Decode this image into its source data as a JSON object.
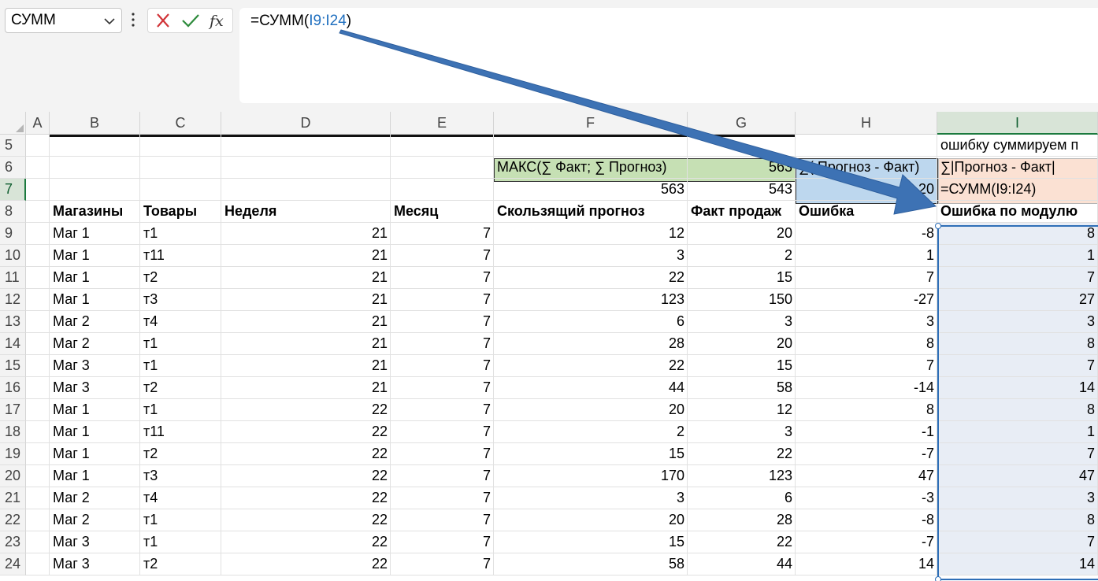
{
  "name_box": {
    "value": "СУММ"
  },
  "formula_bar": {
    "prefix": "=СУММ(",
    "ref": "I9:I24",
    "suffix": ")"
  },
  "columns": [
    "A",
    "B",
    "C",
    "D",
    "E",
    "F",
    "G",
    "H",
    "I"
  ],
  "selected_column": "I",
  "top_rows": [
    {
      "row": "5",
      "i": "ошибку суммируем п"
    },
    {
      "row": "6",
      "f": "МАКС(∑ Факт; ∑ Прогноз)",
      "g": "563",
      "h": "∑( Прогноз - Факт)",
      "i": "∑|Прогноз - Факт|"
    },
    {
      "row": "7",
      "f": "563",
      "g": "543",
      "h": "20",
      "i": "=СУММ(I9:I24)"
    }
  ],
  "headers": {
    "row": "8",
    "b": "Магазины",
    "c": "Товары",
    "d": "Неделя",
    "e": "Месяц",
    "f": "Скользящий прогноз",
    "g": "Факт продаж",
    "h": "Ошибка",
    "i": "Ошибка по модулю"
  },
  "rows": [
    {
      "row": "9",
      "b": "Маг 1",
      "c": "т1",
      "d": "21",
      "e": "7",
      "f": "12",
      "g": "20",
      "h": "-8",
      "i": "8"
    },
    {
      "row": "10",
      "b": "Маг 1",
      "c": "т11",
      "d": "21",
      "e": "7",
      "f": "3",
      "g": "2",
      "h": "1",
      "i": "1"
    },
    {
      "row": "11",
      "b": "Маг 1",
      "c": "т2",
      "d": "21",
      "e": "7",
      "f": "22",
      "g": "15",
      "h": "7",
      "i": "7"
    },
    {
      "row": "12",
      "b": "Маг 1",
      "c": "т3",
      "d": "21",
      "e": "7",
      "f": "123",
      "g": "150",
      "h": "-27",
      "i": "27"
    },
    {
      "row": "13",
      "b": "Маг 2",
      "c": "т4",
      "d": "21",
      "e": "7",
      "f": "6",
      "g": "3",
      "h": "3",
      "i": "3"
    },
    {
      "row": "14",
      "b": "Маг 2",
      "c": "т1",
      "d": "21",
      "e": "7",
      "f": "28",
      "g": "20",
      "h": "8",
      "i": "8"
    },
    {
      "row": "15",
      "b": "Маг 3",
      "c": "т1",
      "d": "21",
      "e": "7",
      "f": "22",
      "g": "15",
      "h": "7",
      "i": "7"
    },
    {
      "row": "16",
      "b": "Маг 3",
      "c": "т2",
      "d": "21",
      "e": "7",
      "f": "44",
      "g": "58",
      "h": "-14",
      "i": "14"
    },
    {
      "row": "17",
      "b": "Маг 1",
      "c": "т1",
      "d": "22",
      "e": "7",
      "f": "20",
      "g": "12",
      "h": "8",
      "i": "8"
    },
    {
      "row": "18",
      "b": "Маг 1",
      "c": "т11",
      "d": "22",
      "e": "7",
      "f": "2",
      "g": "3",
      "h": "-1",
      "i": "1"
    },
    {
      "row": "19",
      "b": "Маг 1",
      "c": "т2",
      "d": "22",
      "e": "7",
      "f": "15",
      "g": "22",
      "h": "-7",
      "i": "7"
    },
    {
      "row": "20",
      "b": "Маг 1",
      "c": "т3",
      "d": "22",
      "e": "7",
      "f": "170",
      "g": "123",
      "h": "47",
      "i": "47"
    },
    {
      "row": "21",
      "b": "Маг 2",
      "c": "т4",
      "d": "22",
      "e": "7",
      "f": "3",
      "g": "6",
      "h": "-3",
      "i": "3"
    },
    {
      "row": "22",
      "b": "Маг 2",
      "c": "т1",
      "d": "22",
      "e": "7",
      "f": "20",
      "g": "28",
      "h": "-8",
      "i": "8"
    },
    {
      "row": "23",
      "b": "Маг 3",
      "c": "т1",
      "d": "22",
      "e": "7",
      "f": "15",
      "g": "22",
      "h": "-7",
      "i": "7"
    },
    {
      "row": "24",
      "b": "Маг 3",
      "c": "т2",
      "d": "22",
      "e": "7",
      "f": "58",
      "g": "44",
      "h": "14",
      "i": "14"
    }
  ],
  "colors": {
    "accent_green": "#1b7a3e",
    "selection_blue": "#2f6fb7",
    "arrow_blue": "#3d72b4",
    "fill_green": "#c6e0b4",
    "fill_blue": "#bdd7ee",
    "fill_orange": "#fbe1d3"
  },
  "icons": {
    "cancel": "x-icon",
    "enter": "checkmark-icon",
    "insert_function": "fx-icon"
  }
}
